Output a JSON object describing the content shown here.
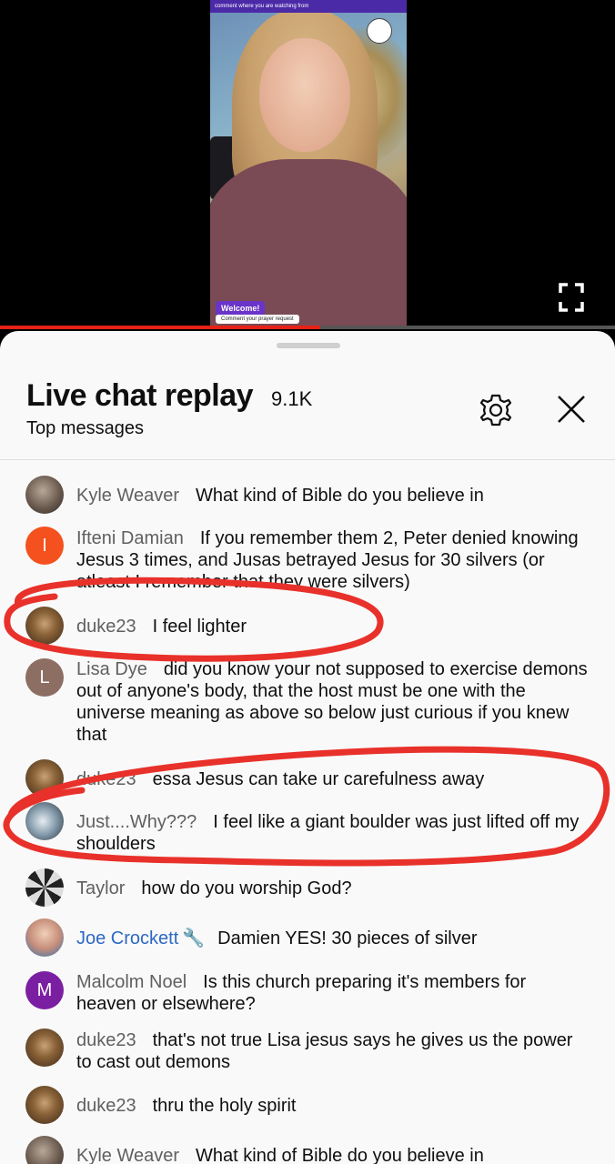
{
  "video": {
    "banner_text": "comment where you are watching from",
    "welcome_label": "Welcome!",
    "prayer_label": "Comment your prayer request",
    "progress": 0.52,
    "fullscreen_icon": "fullscreen-icon"
  },
  "chat": {
    "title": "Live chat replay",
    "count": "9.1K",
    "subtitle": "Top messages",
    "settings_icon": "gear-icon",
    "close_icon": "close-icon"
  },
  "messages": [
    {
      "author": "Kyle Weaver",
      "text": "What kind of Bible do you believe in"
    },
    {
      "author": "Ifteni Damian",
      "avatar_letter": "I",
      "avatar_color": "#f4511e",
      "text": "If you remember them 2, Peter denied knowing Jesus 3 times, and Jusas betrayed Jesus for 30 silvers (or atleast I remember that they were silvers)"
    },
    {
      "author": "duke23",
      "text": "I feel lighter"
    },
    {
      "author": "Lisa Dye",
      "avatar_letter": "L",
      "avatar_color": "#8d6e63",
      "text": "did you know your not supposed to exercise demons out of anyone's body, that the host must be one with the universe meaning as above so below just curious if you knew that"
    },
    {
      "author": "duke23",
      "text": "essa Jesus can take ur carefulness away"
    },
    {
      "author": "Just....Why???",
      "text": "I feel like a giant boulder was just lifted off my shoulders"
    },
    {
      "author": "Taylor",
      "text": "how do you worship God?"
    },
    {
      "author": "Joe Crockett",
      "text": "Damien YES! 30 pieces of silver"
    },
    {
      "author": "Malcolm Noel",
      "avatar_letter": "M",
      "avatar_color": "#7b1fa2",
      "text": "Is this church preparing it's members for heaven or elsewhere?"
    },
    {
      "author": "duke23",
      "text": "that's not true Lisa jesus says he gives us the power to cast out demons"
    },
    {
      "author": "duke23",
      "text": "thru the holy spirit"
    },
    {
      "author": "Kyle Weaver",
      "text": "What kind of Bible do you believe in"
    }
  ],
  "annotation_color": "#e8312a"
}
